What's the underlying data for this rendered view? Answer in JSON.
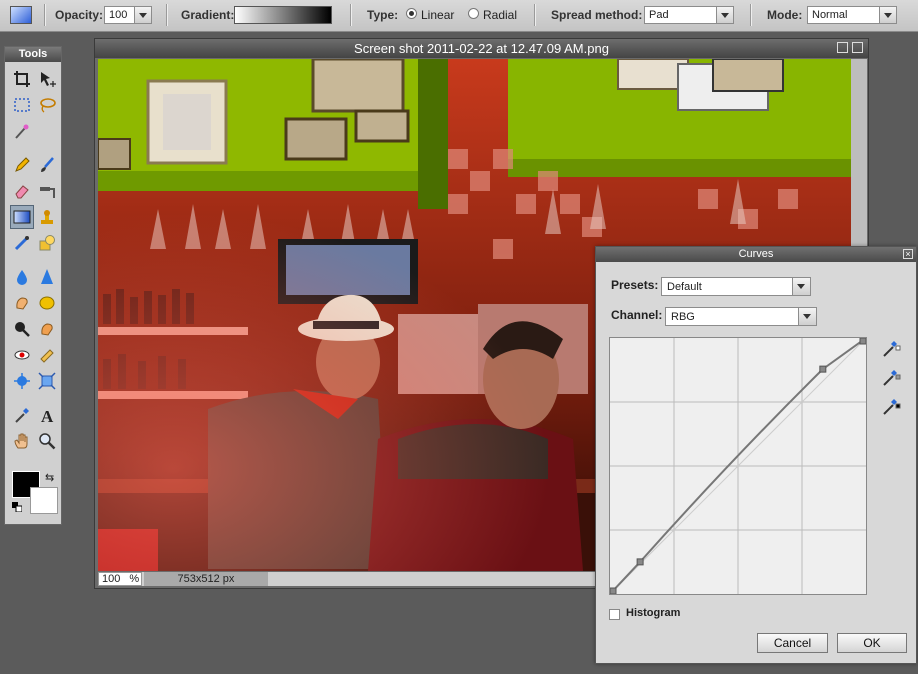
{
  "toolbar": {
    "opacity_label": "Opacity:",
    "opacity_value": "100",
    "gradient_label": "Gradient:",
    "type_label": "Type:",
    "type_linear": "Linear",
    "type_radial": "Radial",
    "type_selected": "Linear",
    "spread_label": "Spread method:",
    "spread_value": "Pad",
    "mode_label": "Mode:",
    "mode_value": "Normal"
  },
  "tools_panel": {
    "title": "Tools",
    "selected_tool": "gradient-tool",
    "foreground_color": "#000000",
    "background_color": "#ffffff"
  },
  "image_window": {
    "title": "Screen shot 2011-02-22 at 12.47.09 AM.png",
    "zoom": "100",
    "zoom_unit": "%",
    "dimensions": "753x512 px"
  },
  "curves": {
    "title": "Curves",
    "presets_label": "Presets:",
    "presets_value": "Default",
    "channel_label": "Channel:",
    "channel_value": "RBG",
    "histogram_label": "Histogram",
    "histogram_checked": false,
    "cancel_label": "Cancel",
    "ok_label": "OK",
    "points": [
      {
        "in": 0,
        "out": 0
      },
      {
        "in": 30,
        "out": 32
      },
      {
        "in": 212,
        "out": 224
      },
      {
        "in": 255,
        "out": 255
      }
    ]
  }
}
